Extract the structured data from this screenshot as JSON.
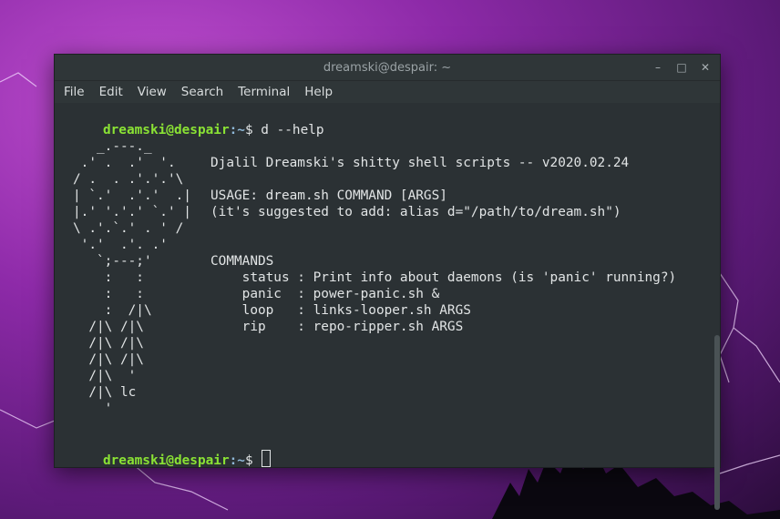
{
  "window": {
    "title": "dreamski@despair: ~",
    "controls": {
      "minimize": "–",
      "maximize": "□",
      "close": "✕"
    }
  },
  "menu": [
    "File",
    "Edit",
    "View",
    "Search",
    "Terminal",
    "Help"
  ],
  "prompt": {
    "user_host": "dreamski@despair",
    "path": ":~",
    "symbol": "$ "
  },
  "command": "d --help",
  "ascii_art": [
    "   _.---._",
    " .' .  .'  '.",
    "/ .  . .'.'.'\\",
    "| `.'  .'.'  .|",
    "|.' '.'.' `.' |",
    "\\ .'.`.' . ' /",
    " '.'  .'. .'",
    "   `;---;'",
    "    :   :",
    "    :   :",
    "    :  /|\\",
    "  /|\\ /|\\",
    "  /|\\ /|\\",
    "  /|\\ /|\\",
    "  /|\\  '",
    "  /|\\ lc",
    "    '"
  ],
  "help": {
    "banner": "Djalil Dreamski's shitty shell scripts -- v2020.02.24",
    "usage": "USAGE: dream.sh COMMAND [ARGS]",
    "suggestion": "(it's suggested to add: alias d=\"/path/to/dream.sh\")",
    "commands_header": "COMMANDS",
    "commands": [
      "    status : Print info about daemons (is 'panic' running?)",
      "    panic  : power-panic.sh &",
      "    loop   : links-looper.sh ARGS",
      "    rip    : repo-ripper.sh ARGS"
    ]
  }
}
